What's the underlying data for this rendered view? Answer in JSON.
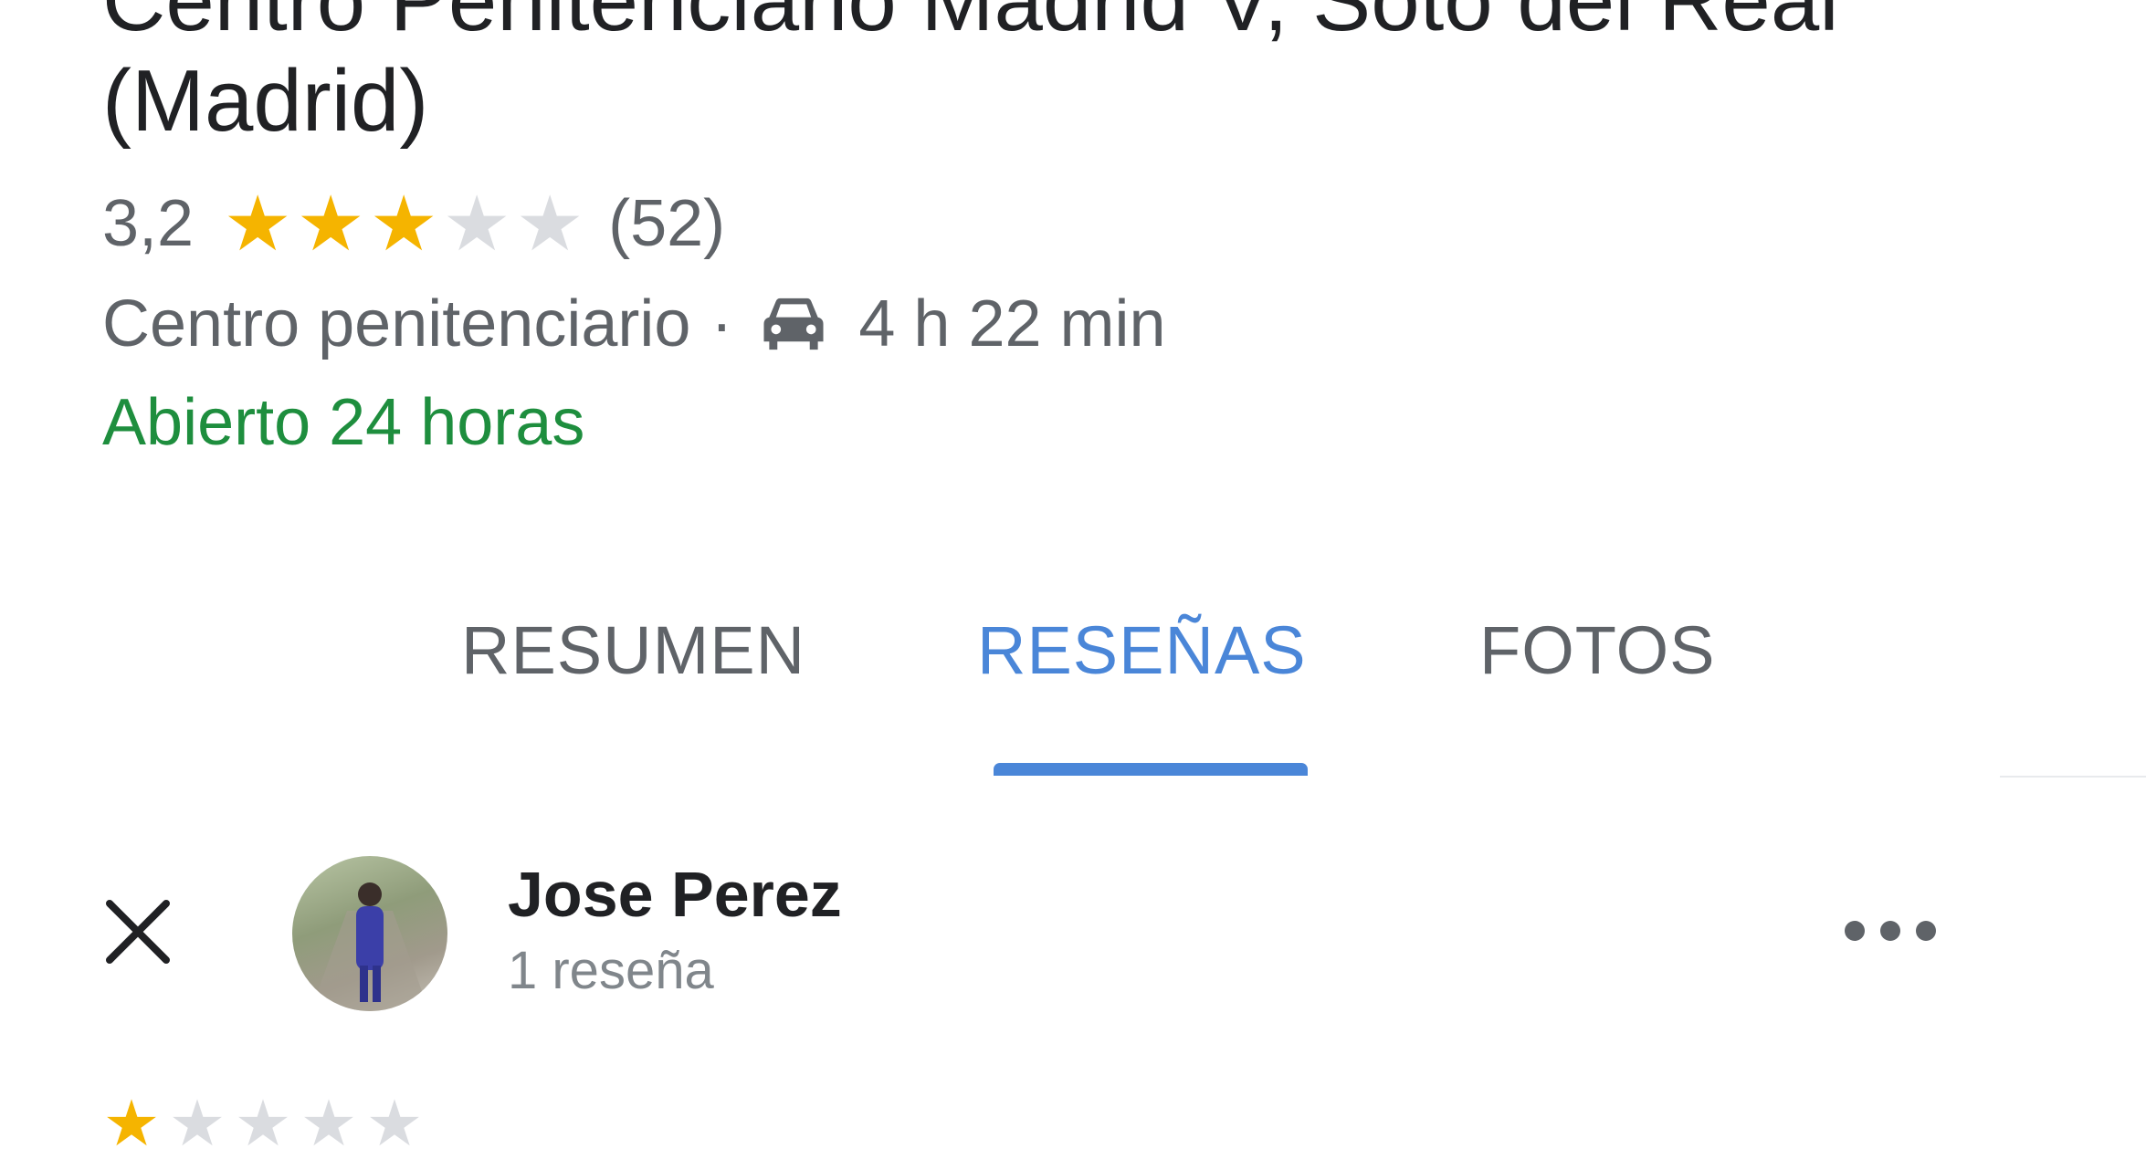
{
  "place": {
    "title_line1": "Centro Penitenciario Madrid V, Soto del Real",
    "title_line2": "(Madrid)",
    "rating_value": "3,2",
    "rating_stars": 3,
    "review_count": "(52)",
    "category": "Centro penitenciario",
    "separator": "·",
    "drive_time": "4 h 22 min",
    "hours_status": "Abierto 24 horas"
  },
  "tabs": [
    {
      "label": "RESUMEN",
      "active": false
    },
    {
      "label": "RESEÑAS",
      "active": true
    },
    {
      "label": "FOTOS",
      "active": false
    }
  ],
  "review": {
    "reviewer_name": "Jose Perez",
    "reviewer_count": "1 reseña",
    "rating_stars": 1
  },
  "icons": {
    "star": "star-icon",
    "car": "car-icon",
    "close": "close-icon",
    "more": "more-horiz-icon"
  },
  "colors": {
    "star_filled": "#f5b400",
    "star_empty": "#dadce0",
    "open_status": "#1e8e3e",
    "active_tab": "#4a86d8",
    "text_primary": "#202124",
    "text_secondary": "#5f6368"
  }
}
